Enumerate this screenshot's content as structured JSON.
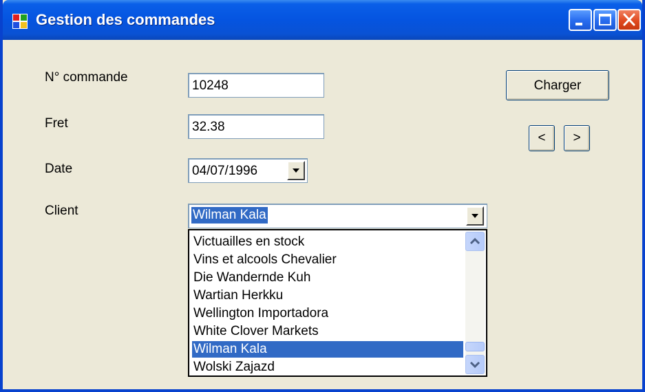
{
  "window": {
    "title": "Gestion des commandes"
  },
  "form": {
    "order_label": "N° commande",
    "order_value": "10248",
    "freight_label": "Fret",
    "freight_value": "32.38",
    "date_label": "Date",
    "date_value": "04/07/1996",
    "client_label": "Client",
    "client_value": "Wilman Kala"
  },
  "buttons": {
    "load_label": "Charger",
    "prev_label": "<",
    "next_label": ">"
  },
  "client_list": {
    "items": [
      "Victuailles en stock",
      "Vins et alcools Chevalier",
      "Die Wandernde Kuh",
      "Wartian Herkku",
      "Wellington Importadora",
      "White Clover Markets",
      "Wilman Kala",
      "Wolski  Zajazd"
    ],
    "selected_index": 6
  },
  "colors": {
    "titlebar": "#0554e0",
    "selection": "#316ac5",
    "face": "#ece9d8"
  }
}
